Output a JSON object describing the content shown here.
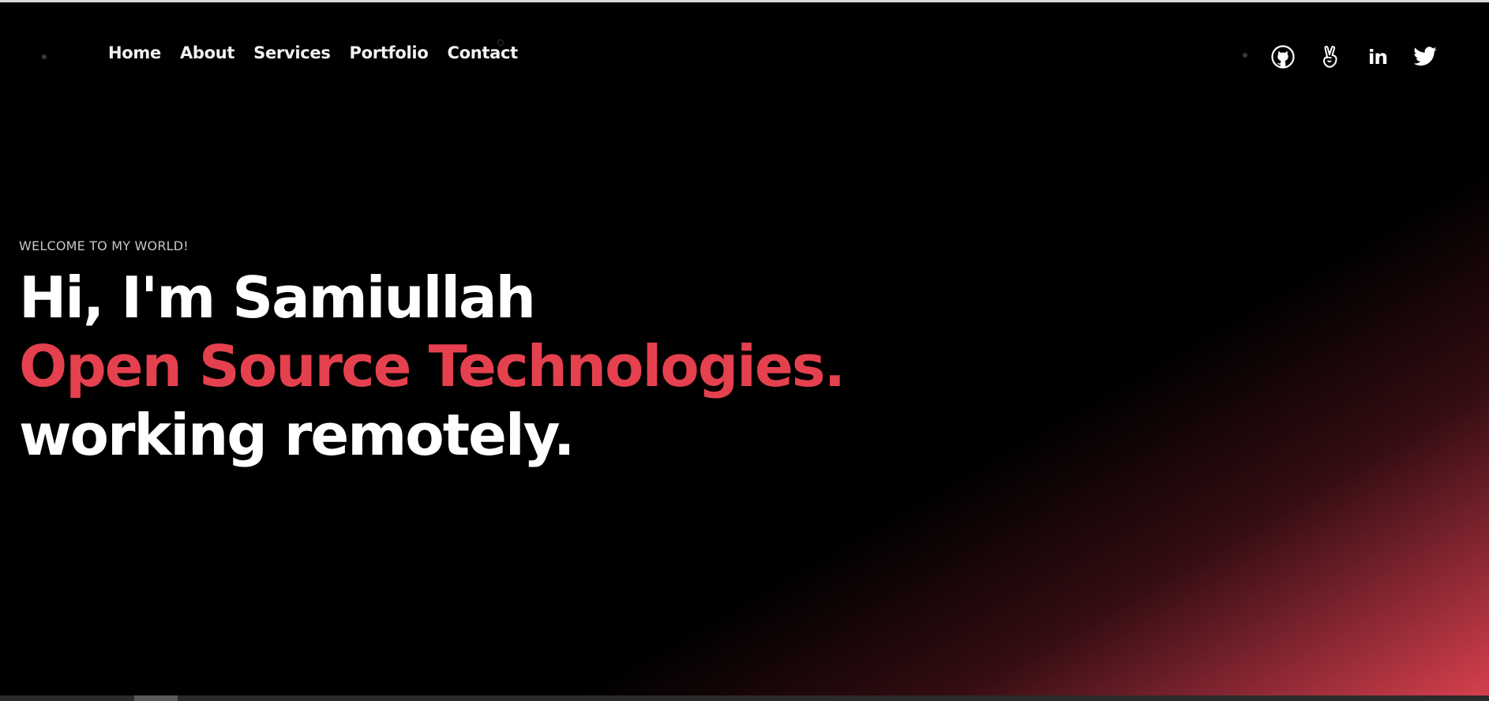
{
  "nav": {
    "items": [
      {
        "label": "Home"
      },
      {
        "label": "About"
      },
      {
        "label": "Services"
      },
      {
        "label": "Portfolio"
      },
      {
        "label": "Contact"
      }
    ]
  },
  "social": {
    "icons": [
      "github-icon",
      "angellist-icon",
      "linkedin-icon",
      "twitter-icon"
    ],
    "linkedin_text": "in"
  },
  "hero": {
    "welcome": "WELCOME TO MY WORLD!",
    "line1": "Hi, I'm Samiullah",
    "line2": "Open Source Technologies.",
    "line3": "working remotely."
  },
  "colors": {
    "background": "#000000",
    "accent": "#e5404e",
    "text": "#ffffff",
    "muted": "#c7c7c7"
  }
}
